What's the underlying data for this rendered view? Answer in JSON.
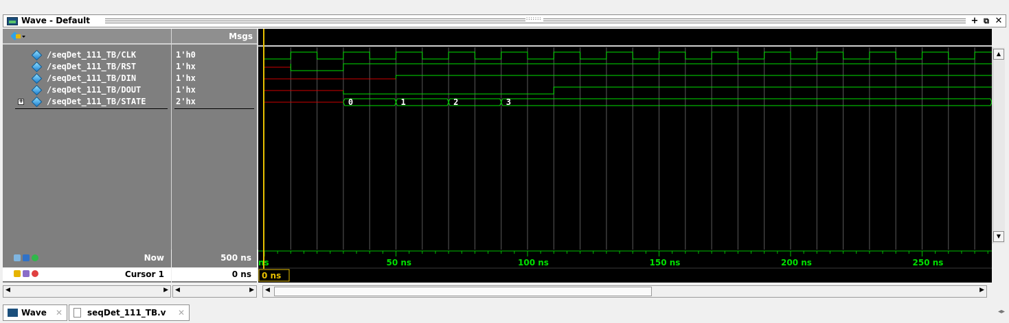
{
  "window": {
    "title": "Wave - Default",
    "dots": ":::::::"
  },
  "panes": {
    "values_header": "Msgs"
  },
  "signals": [
    {
      "name": "/seqDet_111_TB/CLK",
      "value": "1'h0",
      "expandable": false
    },
    {
      "name": "/seqDet_111_TB/RST",
      "value": "1'hx",
      "expandable": false
    },
    {
      "name": "/seqDet_111_TB/DIN",
      "value": "1'hx",
      "expandable": false
    },
    {
      "name": "/seqDet_111_TB/DOUT",
      "value": "1'hx",
      "expandable": false
    },
    {
      "name": "/seqDet_111_TB/STATE",
      "value": "2'hx",
      "expandable": true
    }
  ],
  "state_bus_values": [
    "0",
    "1",
    "2",
    "3"
  ],
  "bottom": {
    "now_label": "Now",
    "now_value": "500 ns",
    "cursor_label": "Cursor 1",
    "cursor_value": "0 ns",
    "cursor_marker": "0 ns"
  },
  "timeline": {
    "first_label": "ns",
    "ticks": [
      "50 ns",
      "100 ns",
      "150 ns",
      "200 ns",
      "250 ns"
    ]
  },
  "colors": {
    "wave_green": "#00e000",
    "wave_red": "#d00000",
    "cursor_yellow": "#e8c000",
    "grid": "#5a5a5a"
  },
  "tabs": [
    {
      "label": "Wave",
      "icon": "wave-window-icon",
      "active": true
    },
    {
      "label": "seqDet_111_TB.v",
      "icon": "file-icon",
      "active": false
    }
  ]
}
